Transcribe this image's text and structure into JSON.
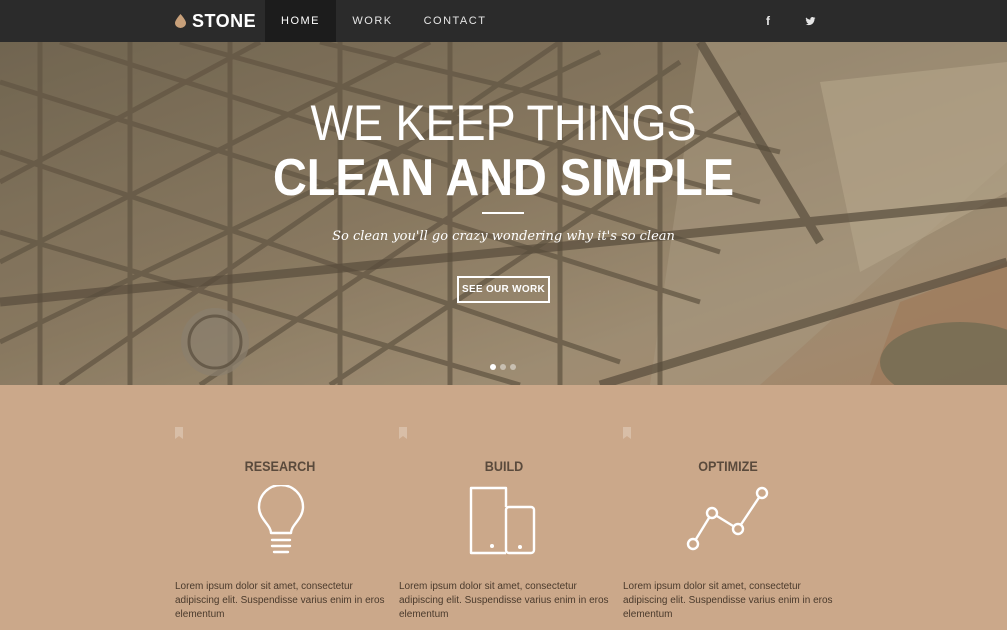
{
  "brand": {
    "name": "STONE",
    "icon": "drop-icon"
  },
  "nav": {
    "items": [
      {
        "label": "HOME",
        "active": true
      },
      {
        "label": "WORK",
        "active": false
      },
      {
        "label": "CONTACT",
        "active": false
      }
    ],
    "social": [
      {
        "name": "facebook-icon",
        "glyph": "f"
      },
      {
        "name": "twitter-icon"
      }
    ]
  },
  "hero": {
    "title_line1": "WE KEEP THINGS",
    "title_line2": "CLEAN AND SIMPLE",
    "tagline": "So clean you'll go crazy wondering why it's so clean",
    "button_label": "SEE OUR WORK",
    "slides": 3,
    "active_slide": 1
  },
  "features": [
    {
      "heading": "RESEARCH",
      "icon": "lightbulb-icon",
      "text": "Lorem ipsum dolor sit amet, consectetur adipiscing elit. Suspendisse varius enim in eros elementum"
    },
    {
      "heading": "BUILD",
      "icon": "devices-icon",
      "text": "Lorem ipsum dolor sit amet, consectetur adipiscing elit. Suspendisse varius enim in eros elementum"
    },
    {
      "heading": "OPTIMIZE",
      "icon": "line-graph-icon",
      "text": "Lorem ipsum dolor sit amet, consectetur adipiscing elit. Suspendisse varius enim in eros elementum"
    }
  ],
  "colors": {
    "nav_bg": "#2b2b2b",
    "nav_active_bg": "#1c1c1c",
    "features_bg": "#cba88a",
    "brand_icon": "#c8a07a"
  }
}
